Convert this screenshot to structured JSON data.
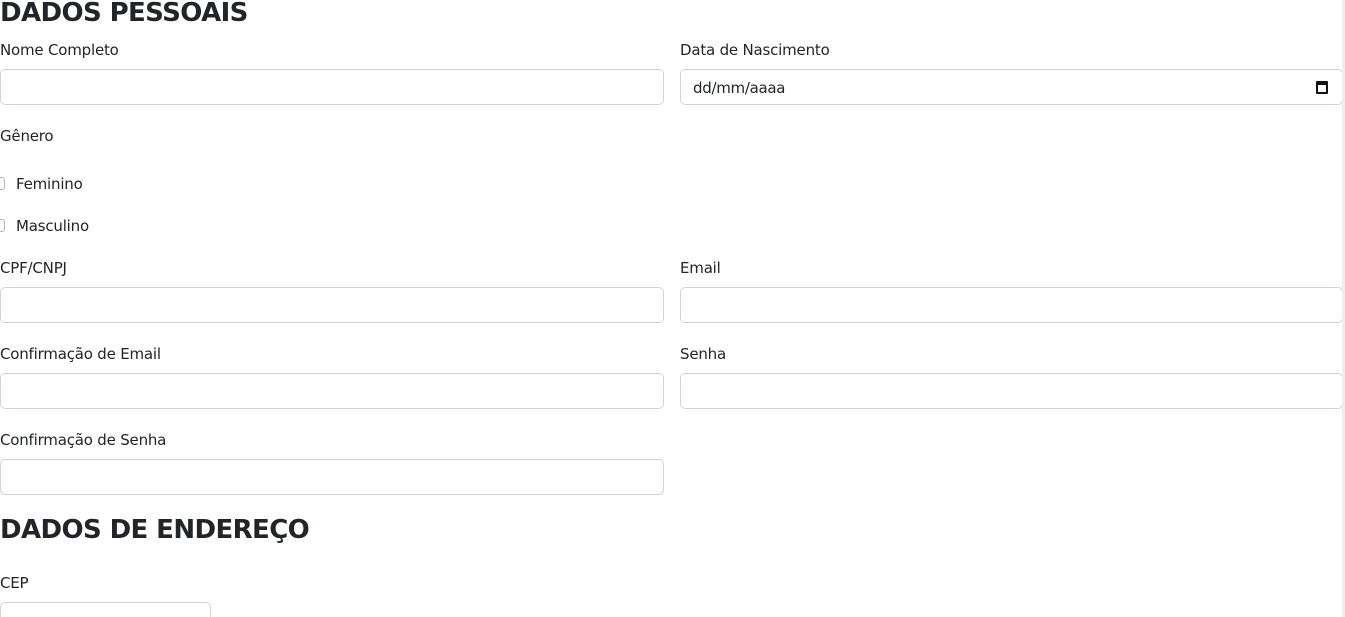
{
  "personal_section": {
    "title": "DADOS PESSOAIS",
    "full_name_label": "Nome Completo",
    "full_name_value": "",
    "birth_date_label": "Data de Nascimento",
    "birth_date_placeholder": "dd/mm/aaaa",
    "gender_label": "Gênero",
    "gender_options": [
      "Feminino",
      "Masculino"
    ],
    "cpf_label": "CPF/CNPJ",
    "email_label": "Email",
    "email_confirm_label": "Confirmação de Email",
    "password_label": "Senha",
    "password_confirm_label": "Confirmação de Senha"
  },
  "address_section": {
    "title": "DADOS DE ENDEREÇO",
    "cep_label": "CEP"
  },
  "icons": {
    "date_picker": "calendar-icon"
  },
  "colors": {
    "text": "#212529",
    "input_border": "#ced4da"
  }
}
